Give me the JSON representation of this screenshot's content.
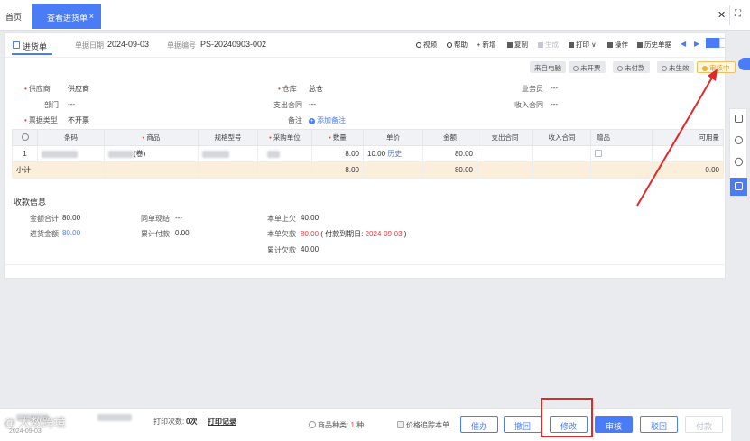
{
  "tabs": {
    "home": "首页",
    "active": "查看进货单",
    "close_glyph": "×"
  },
  "window": {
    "close_glyph": "✕",
    "max_glyph": "⛶"
  },
  "header": {
    "doc_tab": "进货单",
    "date_label": "单据日期",
    "date_value": "2024-09-03",
    "number_label": "单据编号",
    "number_value": "PS-20240903-002"
  },
  "toolbar": {
    "video": "视频",
    "help": "帮助",
    "add": "+ 新增",
    "copy": "复制",
    "generate": "生成",
    "print": "打印 ∨",
    "operate": "操作",
    "history": "历史单据",
    "prev": "◀",
    "next": "▶"
  },
  "status_chips": {
    "source": "来自电脑",
    "invoice": "未开票",
    "payment": "未付款",
    "effect": "未生效",
    "audit": "审核中"
  },
  "form": {
    "supplier_label": "供应商",
    "supplier_value": "供应商",
    "warehouse_label": "仓库",
    "warehouse_value": "总仓",
    "salesperson_label": "业务员",
    "salesperson_value": "---",
    "dept_label": "部门",
    "dept_value": "---",
    "pay_contract_label": "支出合同",
    "pay_contract_value": "---",
    "income_contract_label": "收入合同",
    "income_contract_value": "---",
    "invoice_type_label": "票据类型",
    "invoice_type_value": "不开票",
    "remark_label": "备注",
    "remark_action": "添加备注"
  },
  "table": {
    "headers": [
      "",
      "条码",
      "商品",
      "规格型号",
      "采购单位",
      "数量",
      "单价",
      "金额",
      "支出合同",
      "收入合同",
      "赠品",
      "可用量"
    ],
    "row": {
      "index": "1",
      "product_tail": "(卷)",
      "qty": "8.00",
      "price": "10.00",
      "history": "历史",
      "amount": "80.00"
    },
    "subtotal": {
      "label": "小计",
      "qty": "8.00",
      "amount": "80.00",
      "available": "0.00"
    }
  },
  "payment": {
    "title": "收款信息",
    "total_label": "金额合计",
    "total_value": "80.00",
    "amount_label": "进货金额",
    "amount_value": "80.00",
    "same_label": "同单现结",
    "same_value": "---",
    "cumpay_label": "累计付款",
    "cumpay_value": "0.00",
    "prev_label": "本单上欠",
    "prev_value": "40.00",
    "owe_label": "本单欠款",
    "owe_value": "80.00",
    "due_prefix": "( 付款到期日:",
    "due_date": "2024-09-03",
    "due_suffix": ")",
    "total_owe_label": "累计欠款",
    "total_owe_value": "40.00"
  },
  "bottom": {
    "print_count_label": "打印次数:",
    "print_count_value": "0次",
    "print_record": "打印记录",
    "kinds_label": "商品种类:",
    "kinds_value": "1",
    "kinds_unit": "种",
    "trace_label": "价格追踪本单",
    "btn_urge": "催办",
    "btn_withdraw": "撤回",
    "btn_edit": "修改",
    "btn_audit": "审核",
    "btn_reject": "驳回",
    "btn_pay": "付款"
  },
  "watermark": {
    "text": "@ 大数跨境",
    "date": "2024-09-03"
  },
  "colors": {
    "accent": "#4a7cf6",
    "danger": "#e84040",
    "annotation": "#e4282a",
    "warning": "#f0b030"
  }
}
